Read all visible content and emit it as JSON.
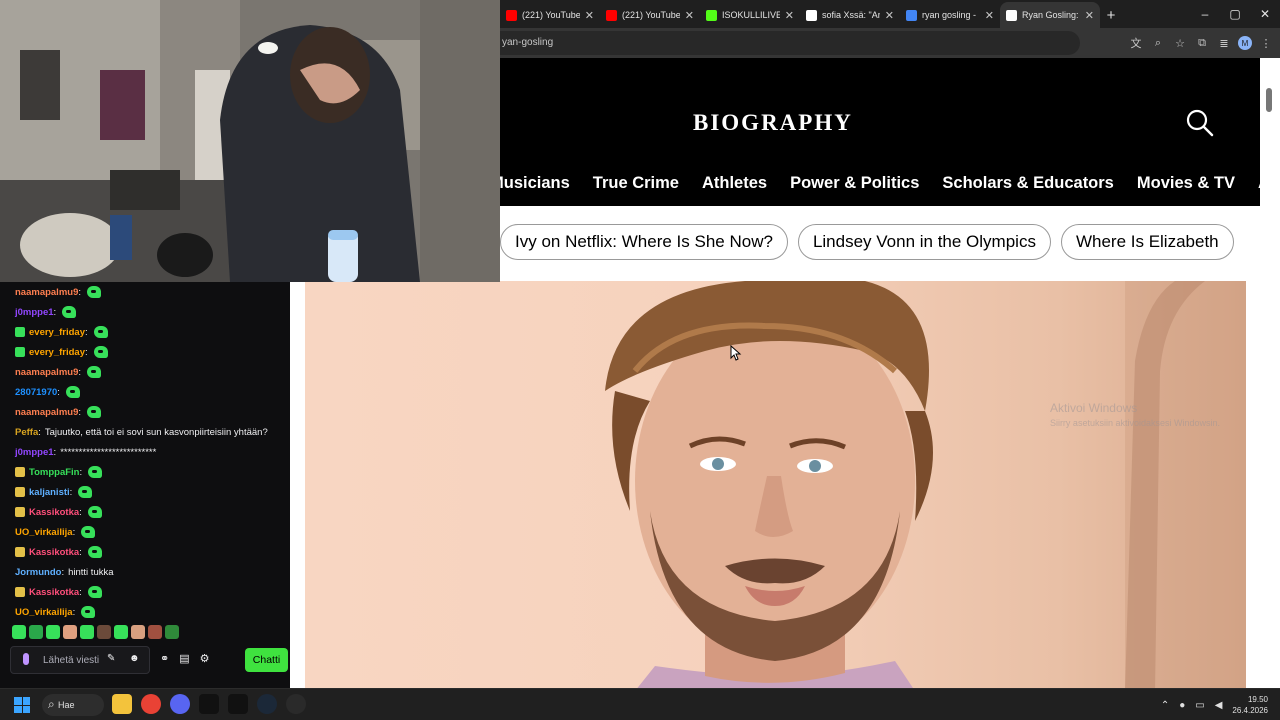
{
  "browser": {
    "tabs": [
      {
        "label": "(221) YouTube",
        "icon": "youtube-icon",
        "color": "#ff0000"
      },
      {
        "label": "(221) YouTube",
        "icon": "youtube-icon",
        "color": "#ff0000"
      },
      {
        "label": "ISOKULLILIVE",
        "icon": "kick-icon",
        "color": "#53fc18"
      },
      {
        "label": "sofia Xssä: \"Ar",
        "icon": "x-icon",
        "color": "#ffffff"
      },
      {
        "label": "ryan gosling -",
        "icon": "google-icon",
        "color": "#4285f4"
      },
      {
        "label": "Ryan Gosling:",
        "icon": "biography-icon",
        "color": "#ffffff",
        "active": true
      }
    ],
    "url": "yan-gosling",
    "close_glyph": "✕",
    "new_tab_glyph": "+",
    "window_controls": {
      "minimize": "–",
      "maximize": "▢",
      "close": "✕"
    },
    "profile_initial": "M"
  },
  "site": {
    "logo": "BIOGRAPHY",
    "nav": [
      "Musicians",
      "True Crime",
      "Athletes",
      "Power & Politics",
      "Scholars & Educators",
      "Movies & TV",
      "About"
    ],
    "chips": [
      "Ivy on Netflix: Where Is She Now?",
      "Lindsey Vonn in the Olympics",
      "Where Is Elizabeth"
    ],
    "watermark_line1": "Aktivoi Windows",
    "watermark_line2": "Siirry asetuksiin aktivoidaksesi Windowsin."
  },
  "chat": {
    "messages": [
      {
        "user": "naamapalmu9",
        "color": "#ff7f50",
        "text": "",
        "badge": null,
        "emote": true
      },
      {
        "user": "j0mppe1",
        "color": "#9146ff",
        "text": "",
        "badge": null,
        "emote": true
      },
      {
        "user": "every_friday",
        "color": "#ffa500",
        "text": "",
        "badge": "#37e05a",
        "emote": true
      },
      {
        "user": "every_friday",
        "color": "#ffa500",
        "text": "",
        "badge": "#37e05a",
        "emote": true
      },
      {
        "user": "naamapalmu9",
        "color": "#ff7f50",
        "text": "",
        "badge": null,
        "emote": true
      },
      {
        "user": "28071970",
        "color": "#1e90ff",
        "text": "",
        "badge": null,
        "emote": true
      },
      {
        "user": "naamapalmu9",
        "color": "#ff7f50",
        "text": "",
        "badge": null,
        "emote": true
      },
      {
        "user": "Peffa",
        "color": "#daa520",
        "text": "Tajuutko, että toi ei sovi sun kasvonpiirteisiin yhtään?",
        "badge": null,
        "emote": false
      },
      {
        "user": "j0mppe1",
        "color": "#9146ff",
        "text": "**************************",
        "badge": null,
        "emote": false
      },
      {
        "user": "TomppaFin",
        "color": "#37e05a",
        "text": "",
        "badge": "#e3c048",
        "emote": true
      },
      {
        "user": "kaljanisti",
        "color": "#5fb0ff",
        "text": "",
        "badge": "#e3c048",
        "emote": true
      },
      {
        "user": "Kassikotka",
        "color": "#ff4f7b",
        "text": "",
        "badge": "#e3c048",
        "emote": true
      },
      {
        "user": "UO_virkailija",
        "color": "#ffa500",
        "text": "",
        "badge": null,
        "emote": true
      },
      {
        "user": "Kassikotka",
        "color": "#ff4f7b",
        "text": "",
        "badge": "#e3c048",
        "emote": true
      },
      {
        "user": "Jormundo",
        "color": "#5fb0ff",
        "text": "hintti tukka",
        "badge": null,
        "emote": false
      },
      {
        "user": "Kassikotka",
        "color": "#ff4f7b",
        "text": "",
        "badge": "#e3c048",
        "emote": true
      },
      {
        "user": "UO_virkailija",
        "color": "#ffa500",
        "text": "",
        "badge": null,
        "emote": true
      }
    ],
    "input_placeholder": "Lähetä viesti",
    "send_label": "Chatti"
  },
  "taskbar": {
    "search_label": "Hae",
    "time": "19.50",
    "date": "26.4.2026"
  }
}
